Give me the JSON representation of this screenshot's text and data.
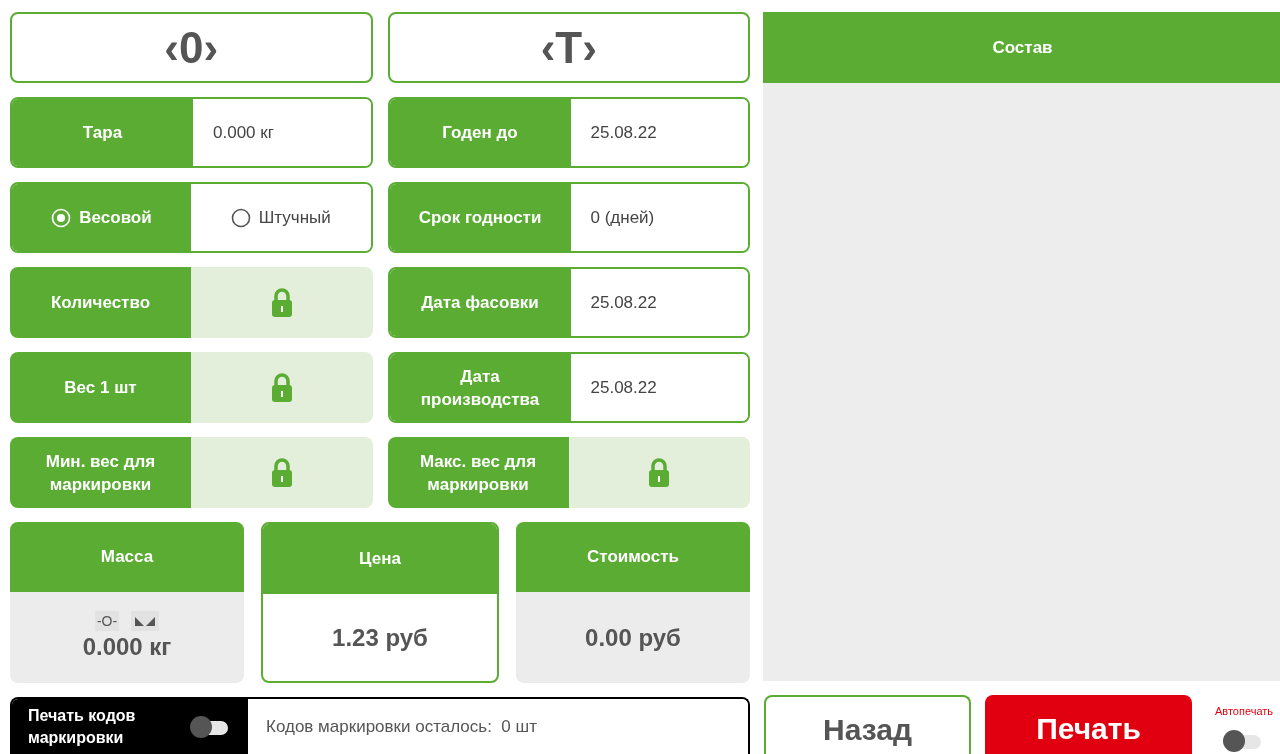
{
  "indicators": [
    {
      "text": "‹0›"
    },
    {
      "text": "‹T›"
    }
  ],
  "left_fields": [
    {
      "kind": "value",
      "label": "Тара",
      "value": "0.000 кг"
    },
    {
      "kind": "mode",
      "options": [
        {
          "label": "Весовой",
          "selected": true
        },
        {
          "label": "Штучный",
          "selected": false
        }
      ]
    },
    {
      "kind": "locked",
      "label": "Количество"
    },
    {
      "kind": "locked",
      "label": "Вес 1 шт"
    },
    {
      "kind": "locked",
      "label": "Мин. вес для маркировки"
    }
  ],
  "right_fields": [
    {
      "kind": "value",
      "label": "Годен до",
      "value": "25.08.22"
    },
    {
      "kind": "value",
      "label": "Срок годности",
      "value": "0 (дней)"
    },
    {
      "kind": "value",
      "label": "Дата фасовки",
      "value": "25.08.22"
    },
    {
      "kind": "value",
      "label": "Дата производства",
      "value": "25.08.22"
    },
    {
      "kind": "locked",
      "label": "Макс. вес для маркировки"
    }
  ],
  "totals": [
    {
      "label": "Масса",
      "value": "0.000 кг",
      "selected": false,
      "zero_mark": "-O-",
      "stable": true
    },
    {
      "label": "Цена",
      "value": "1.23 руб",
      "selected": true
    },
    {
      "label": "Стоимость",
      "value": "0.00 руб",
      "selected": false
    }
  ],
  "marking": {
    "label": "Печать кодов маркировки",
    "on": false,
    "status": "Кодов маркировки осталось:  0 шт"
  },
  "composition": {
    "title": "Состав"
  },
  "buttons": [
    {
      "kind": "back",
      "label": "Назад"
    },
    {
      "kind": "print",
      "label": "Печать"
    }
  ],
  "autoprint": {
    "label": "Автопечать",
    "on": false
  }
}
